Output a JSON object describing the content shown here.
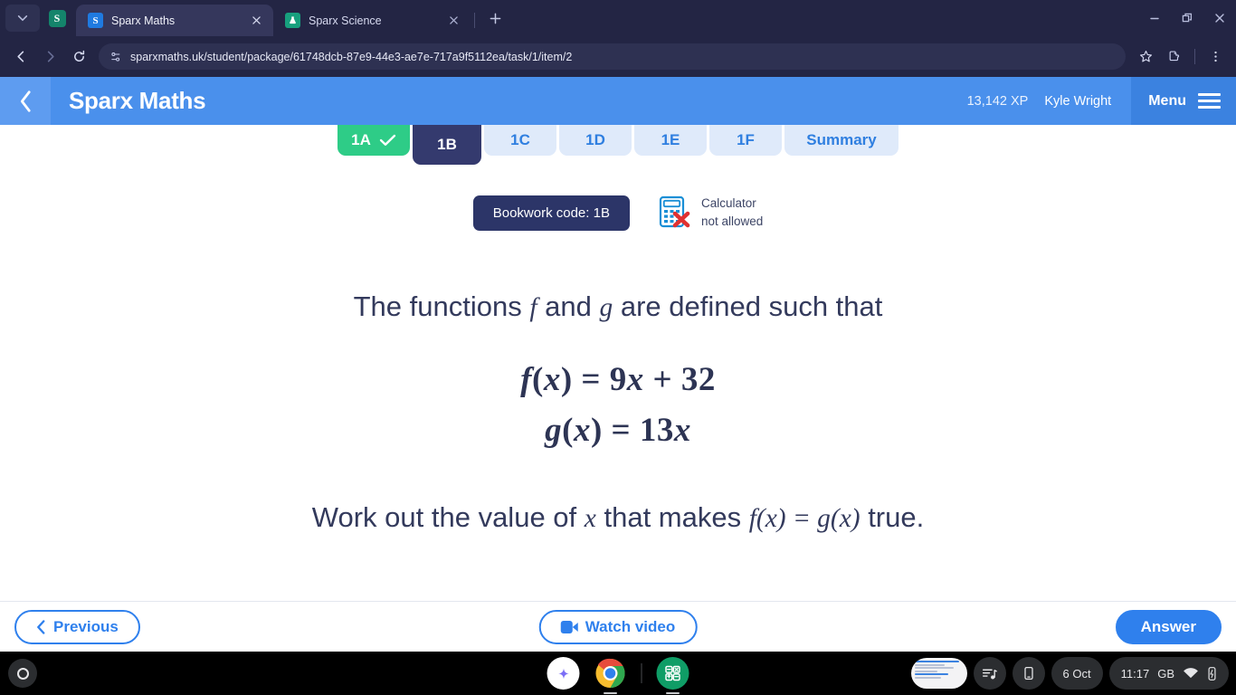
{
  "browser": {
    "tabs": [
      {
        "title": "Sparx Maths",
        "favicon_letter": "S",
        "active": true
      },
      {
        "title": "Sparx Science",
        "favicon_letter": "⚗",
        "active": false
      }
    ],
    "url": "sparxmaths.uk/student/package/61748dcb-87e9-44e3-ae7e-717a9f5112ea/task/1/item/2",
    "pinned_icon_letter": "S",
    "window_controls": [
      "minimize",
      "restore",
      "close"
    ]
  },
  "app": {
    "brand": "Sparx Maths",
    "xp": "13,142 XP",
    "user": "Kyle Wright",
    "menu_label": "Menu",
    "accent": "#4a90ec",
    "task_tabs": [
      {
        "label": "1A",
        "state": "done"
      },
      {
        "label": "1B",
        "state": "current"
      },
      {
        "label": "1C",
        "state": "todo"
      },
      {
        "label": "1D",
        "state": "todo"
      },
      {
        "label": "1E",
        "state": "todo"
      },
      {
        "label": "1F",
        "state": "todo"
      },
      {
        "label": "Summary",
        "state": "todo"
      }
    ],
    "bookwork_code": "Bookwork code: 1B",
    "calculator_line1": "Calculator",
    "calculator_line2": "not allowed"
  },
  "question": {
    "intro_part1": "The functions",
    "intro_var_f": "f",
    "intro_and": "and",
    "intro_var_g": "g",
    "intro_part2": "are defined such that",
    "equation_1": "f(x) = 9x + 32",
    "equation_2": "g(x) = 13x",
    "prompt_part1": "Work out the value of",
    "prompt_var_x": "x",
    "prompt_part2": "that makes",
    "prompt_eq": "f(x) = g(x)",
    "prompt_part3": "true."
  },
  "footer": {
    "previous_label": "Previous",
    "watch_video_label": "Watch video",
    "answer_label": "Answer"
  },
  "shelf": {
    "date": "6 Oct",
    "time": "11:17",
    "locale": "GB",
    "apps": [
      "gemini-icon",
      "chrome-icon",
      "calculator-icon"
    ]
  }
}
